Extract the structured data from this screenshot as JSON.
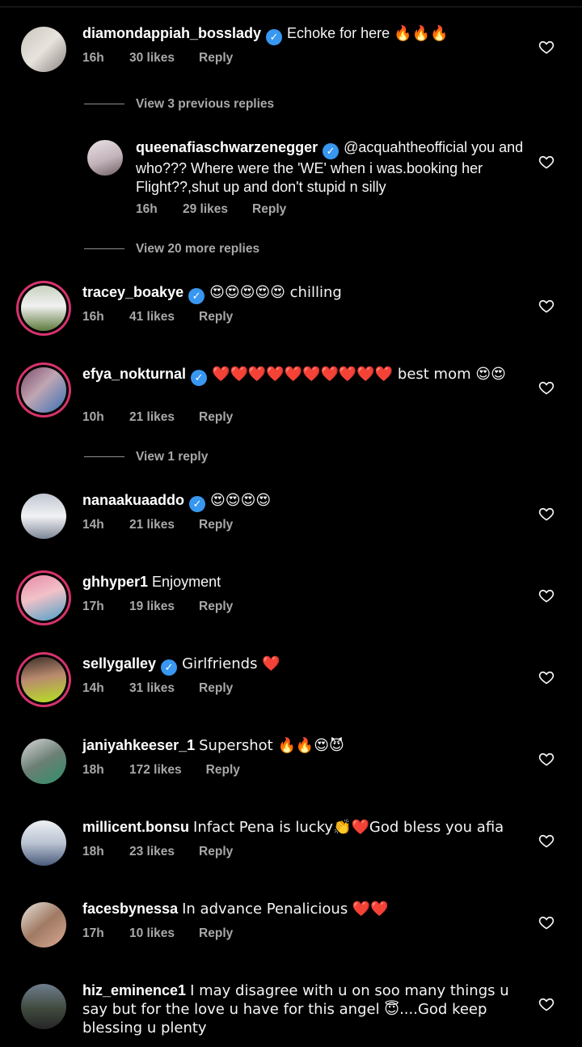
{
  "comments": [
    {
      "username": "diamondappiah_bosslady",
      "verified": true,
      "text": "Echoke for here 🔥🔥🔥",
      "time": "16h",
      "likes": "30 likes",
      "reply": "Reply"
    },
    {
      "username": "queenafiaschwarzenegger",
      "verified": true,
      "text": "@acquahtheofficial you and who??? Where were the 'WE' when i was.booking her Flight??,shut up and don't stupid n silly",
      "time": "16h",
      "likes": "29 likes",
      "reply": "Reply"
    },
    {
      "username": "tracey_boakye",
      "verified": true,
      "text": "😍😍😍😍😍 chilling",
      "time": "16h",
      "likes": "41 likes",
      "reply": "Reply"
    },
    {
      "username": "efya_nokturnal",
      "verified": true,
      "text": "❤️❤️❤️❤️❤️❤️❤️❤️❤️❤️ best mom 😍😍",
      "time": "10h",
      "likes": "21 likes",
      "reply": "Reply"
    },
    {
      "username": "nanaakuaaddo",
      "verified": true,
      "text": "😍😍😍😍",
      "time": "14h",
      "likes": "21 likes",
      "reply": "Reply"
    },
    {
      "username": "ghhyper1",
      "verified": false,
      "text": "Enjoyment",
      "time": "17h",
      "likes": "19 likes",
      "reply": "Reply"
    },
    {
      "username": "sellygalley",
      "verified": true,
      "text": "Girlfriends ❤️",
      "time": "14h",
      "likes": "31 likes",
      "reply": "Reply"
    },
    {
      "username": "janiyahkeeser_1",
      "verified": false,
      "text": "Supershot 🔥🔥😍😈",
      "time": "18h",
      "likes": "172 likes",
      "reply": "Reply"
    },
    {
      "username": "millicent.bonsu",
      "verified": false,
      "text": "Infact Pena is lucky👏❤️God bless you afia",
      "time": "18h",
      "likes": "23 likes",
      "reply": "Reply"
    },
    {
      "username": "facesbynessa",
      "verified": false,
      "text": "In advance Penalicious ❤️❤️",
      "time": "17h",
      "likes": "10 likes",
      "reply": "Reply"
    },
    {
      "username": "hiz_eminence1",
      "verified": false,
      "text": "I may disagree with u on soo many things u say but for the love u have for this angel 😇....God keep blessing u plenty",
      "time": "",
      "likes": "",
      "reply": ""
    }
  ],
  "view_replies": [
    "View 3 previous replies",
    "View 20 more replies",
    "View 1 reply"
  ],
  "colors": {
    "background": "#000000",
    "verified": "#3897f0",
    "meta": "#a8a8a8",
    "story_ring": "#d6336c"
  }
}
